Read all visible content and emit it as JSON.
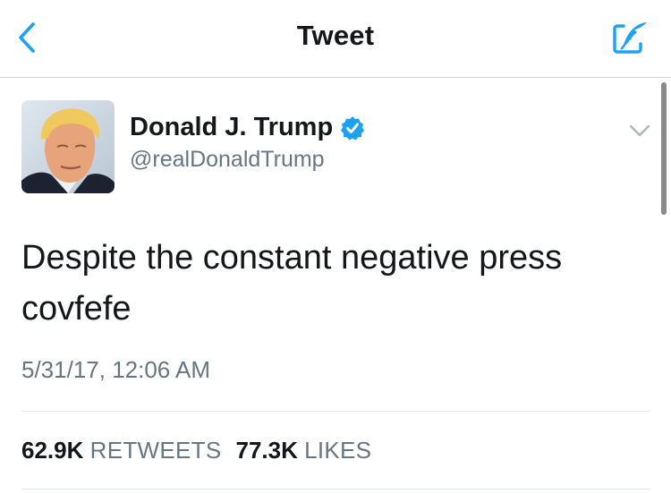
{
  "colors": {
    "accent": "#1da1f2",
    "secondary_text": "#657786",
    "primary_text": "#14171a"
  },
  "nav": {
    "back_icon": "chevron-left-icon",
    "title": "Tweet",
    "compose_icon": "compose-quill-icon"
  },
  "tweet": {
    "author": {
      "name": "Donald J. Trump",
      "handle": "@realDonaldTrump",
      "verified": true,
      "avatar_icon": "profile-photo"
    },
    "menu_icon": "chevron-down-icon",
    "text": "Despite the constant negative press covfefe",
    "timestamp": "5/31/17, 12:06 AM",
    "stats": {
      "retweets_count": "62.9K",
      "retweets_label": "RETWEETS",
      "likes_count": "77.3K",
      "likes_label": "LIKES"
    }
  }
}
